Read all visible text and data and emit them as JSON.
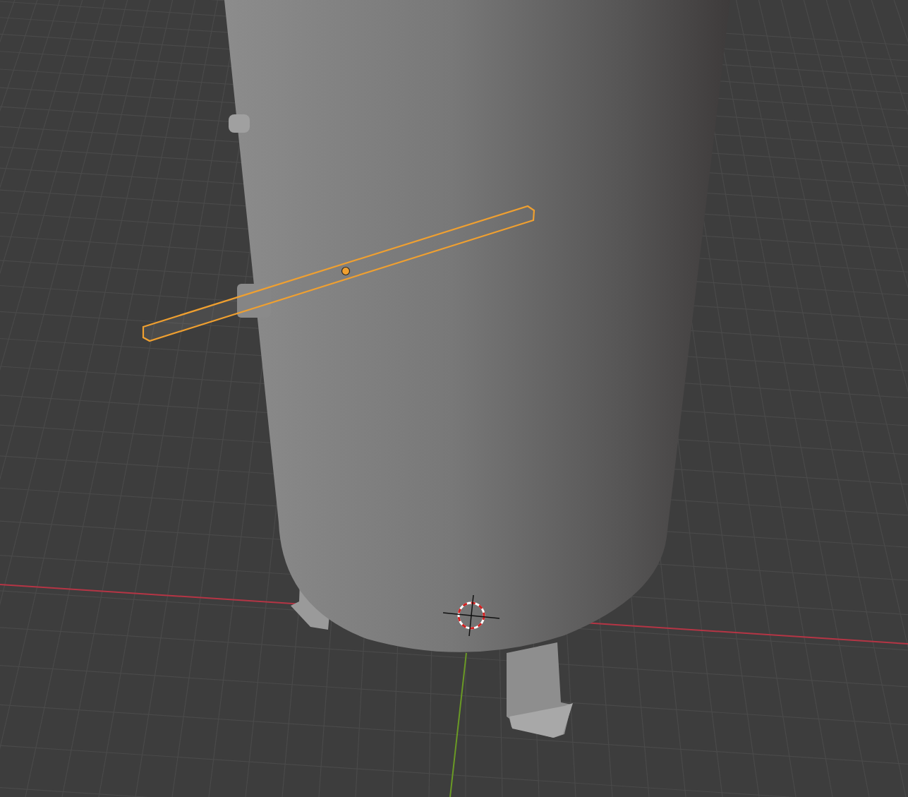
{
  "viewport": {
    "objects": [
      {
        "kind": "leg",
        "selected": false
      },
      {
        "kind": "tank",
        "selected": false
      },
      {
        "kind": "nozzle",
        "selected": false
      },
      {
        "kind": "rod",
        "selected": true
      },
      {
        "kind": "cursor",
        "selected": false
      }
    ]
  }
}
